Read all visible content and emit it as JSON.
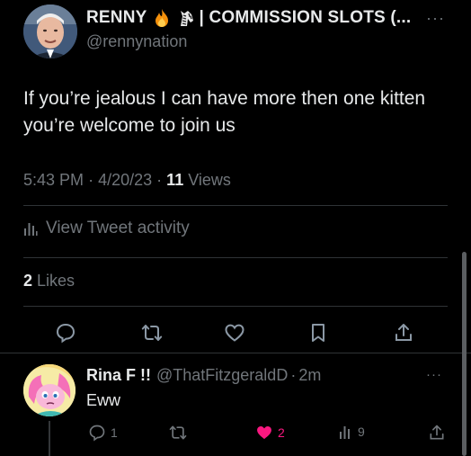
{
  "tweet": {
    "display_name": "RENNY",
    "display_name_suffix": "| COMMISSION SLOTS (...",
    "handle": "@rennynation",
    "text": "If you’re jealous I can have more then one kitten you’re welcome to join us",
    "time": "5:43 PM",
    "date": "4/20/23",
    "separator": "·",
    "views_count": "11",
    "views_label": "Views",
    "activity_label": "View Tweet activity",
    "likes_count": "2",
    "likes_label": "Likes",
    "more": "···"
  },
  "reply": {
    "display_name": "Rina F !!",
    "handle": "@ThatFitzgeraldD",
    "separator": "·",
    "age": "2m",
    "text": "Eww",
    "reply_count": "1",
    "like_count": "2",
    "views_count": "9",
    "more": "···"
  },
  "colors": {
    "background": "#000000",
    "text": "#e7e9ea",
    "muted": "#71767b",
    "divider": "#2f3336",
    "like": "#f91880"
  },
  "icons": [
    "fire-icon",
    "zebra-icon",
    "more-icon",
    "activity-chart-icon",
    "reply-icon",
    "retweet-icon",
    "like-icon",
    "bookmark-icon",
    "share-icon"
  ]
}
